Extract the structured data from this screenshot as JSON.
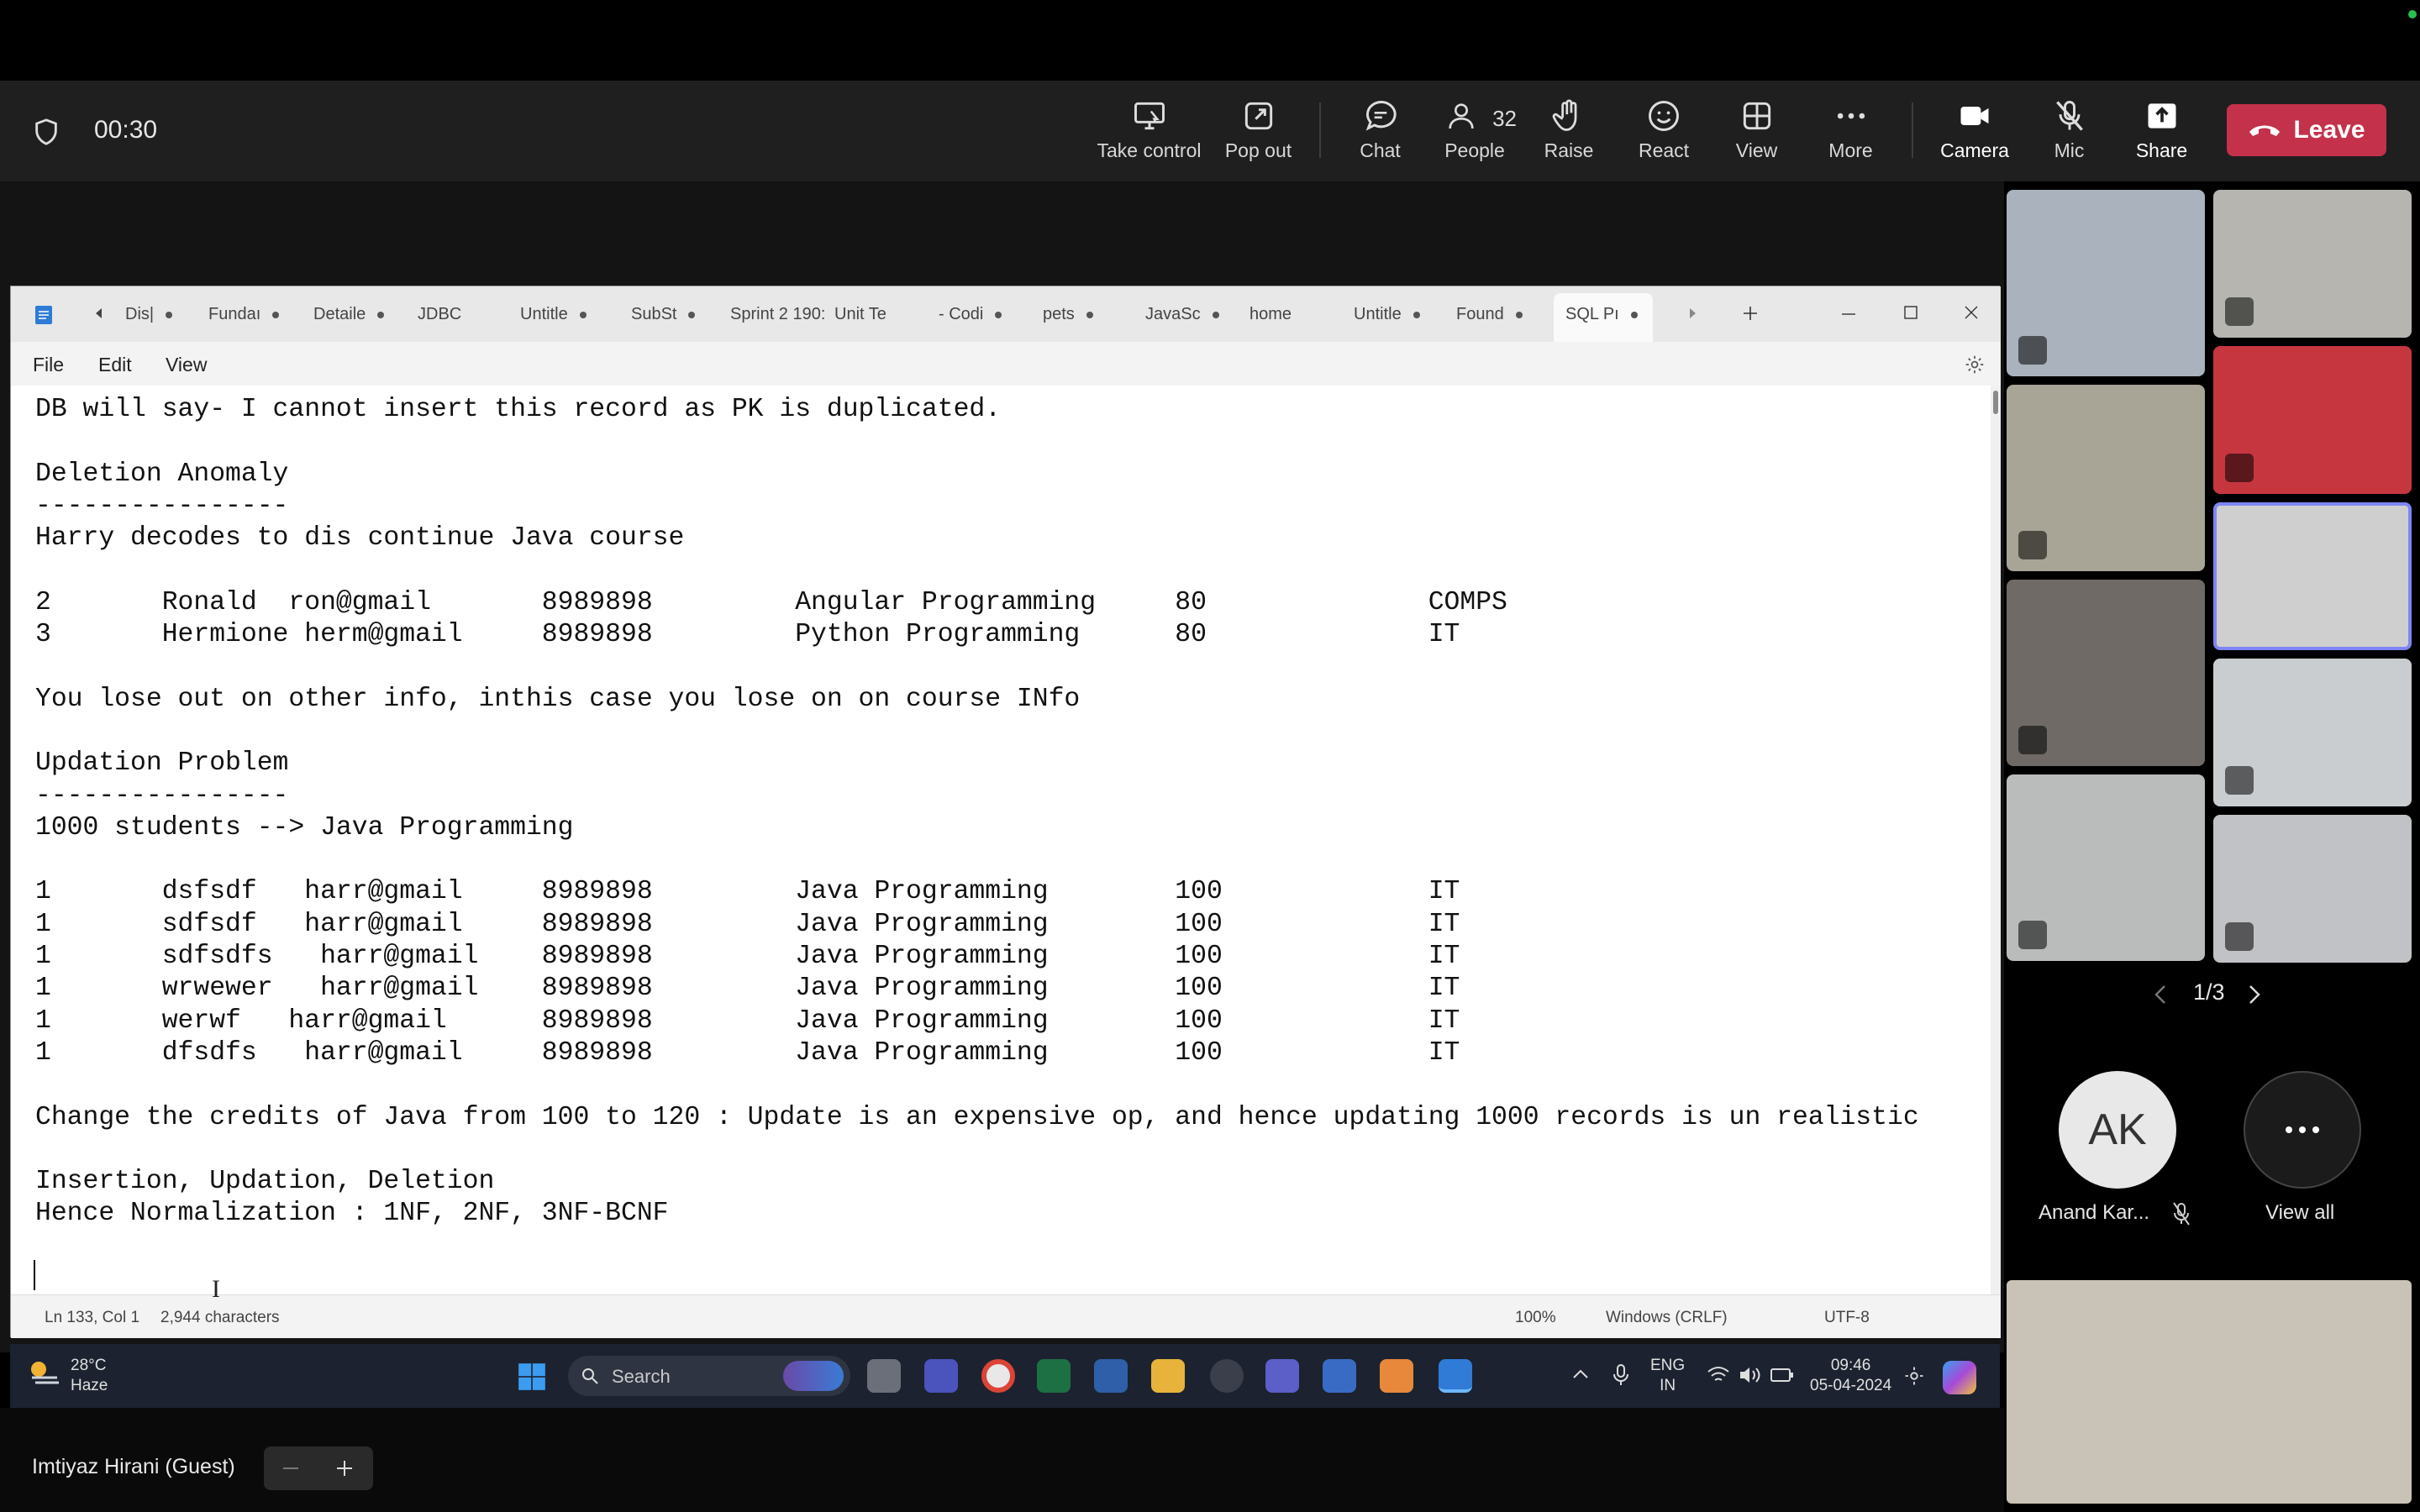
{
  "meeting": {
    "timer": "00:30",
    "toolbar": [
      {
        "id": "take-control",
        "label": "Take control"
      },
      {
        "id": "pop-out",
        "label": "Pop out"
      },
      {
        "id": "chat",
        "label": "Chat"
      },
      {
        "id": "people",
        "label": "People",
        "count": "32"
      },
      {
        "id": "raise",
        "label": "Raise"
      },
      {
        "id": "react",
        "label": "React"
      },
      {
        "id": "view",
        "label": "View"
      },
      {
        "id": "more",
        "label": "More"
      },
      {
        "id": "camera",
        "label": "Camera"
      },
      {
        "id": "mic",
        "label": "Mic"
      },
      {
        "id": "share",
        "label": "Share"
      }
    ],
    "leave_label": "Leave",
    "leave_color": "#c4314b",
    "page_indicator": "1/3",
    "participant_name": "Anand Kar...",
    "participant_initials": "AK",
    "view_all_label": "View all",
    "guest_name": "Imtiyaz Hirani (Guest)"
  },
  "notepad": {
    "tabs": [
      "Dis|",
      "Fundaı",
      "Detaile",
      "JDBC",
      "Untitle",
      "SubSt",
      "Sprint 2 190:",
      "Unit Te",
      "- Codi",
      "pets",
      "JavaSc",
      "home",
      "Untitle",
      "Found",
      "SQL Pı"
    ],
    "active_tab": "SQL Pı",
    "menu": {
      "file": "File",
      "edit": "Edit",
      "view": "View"
    },
    "lines": [
      "DB will say- I cannot insert this record as PK is duplicated.",
      "",
      "Deletion Anomaly",
      "----------------",
      "Harry decodes to dis continue Java course",
      "",
      "2       Ronald  ron@gmail       8989898         Angular Programming     80              COMPS",
      "3       Hermione herm@gmail     8989898         Python Programming      80              IT",
      "",
      "You lose out on other info, inthis case you lose on on course INfo",
      "",
      "Updation Problem",
      "----------------",
      "1000 students --> Java Programming",
      "",
      "1       dsfsdf   harr@gmail     8989898         Java Programming        100             IT",
      "1       sdfsdf   harr@gmail     8989898         Java Programming        100             IT",
      "1       sdfsdfs   harr@gmail    8989898         Java Programming        100             IT",
      "1       wrwewer   harr@gmail    8989898         Java Programming        100             IT",
      "1       werwf   harr@gmail      8989898         Java Programming        100             IT",
      "1       dfsdfs   harr@gmail     8989898         Java Programming        100             IT",
      "",
      "Change the credits of Java from 100 to 120 : Update is an expensive op, and hence updating 1000 records is un realistic",
      "",
      "Insertion, Updation, Deletion",
      "Hence Normalization : 1NF, 2NF, 3NF-BCNF",
      "",
      ""
    ],
    "status": {
      "position": "Ln 133, Col 1",
      "characters": "2,944 characters",
      "zoom": "100%",
      "line_ending": "Windows (CRLF)",
      "encoding": "UTF-8"
    }
  },
  "taskbar": {
    "weather_temp": "28°C",
    "weather_desc": "Haze",
    "search_placeholder": "Search",
    "lang": "ENG",
    "region": "IN",
    "time": "09:46",
    "date": "05-04-2024"
  }
}
